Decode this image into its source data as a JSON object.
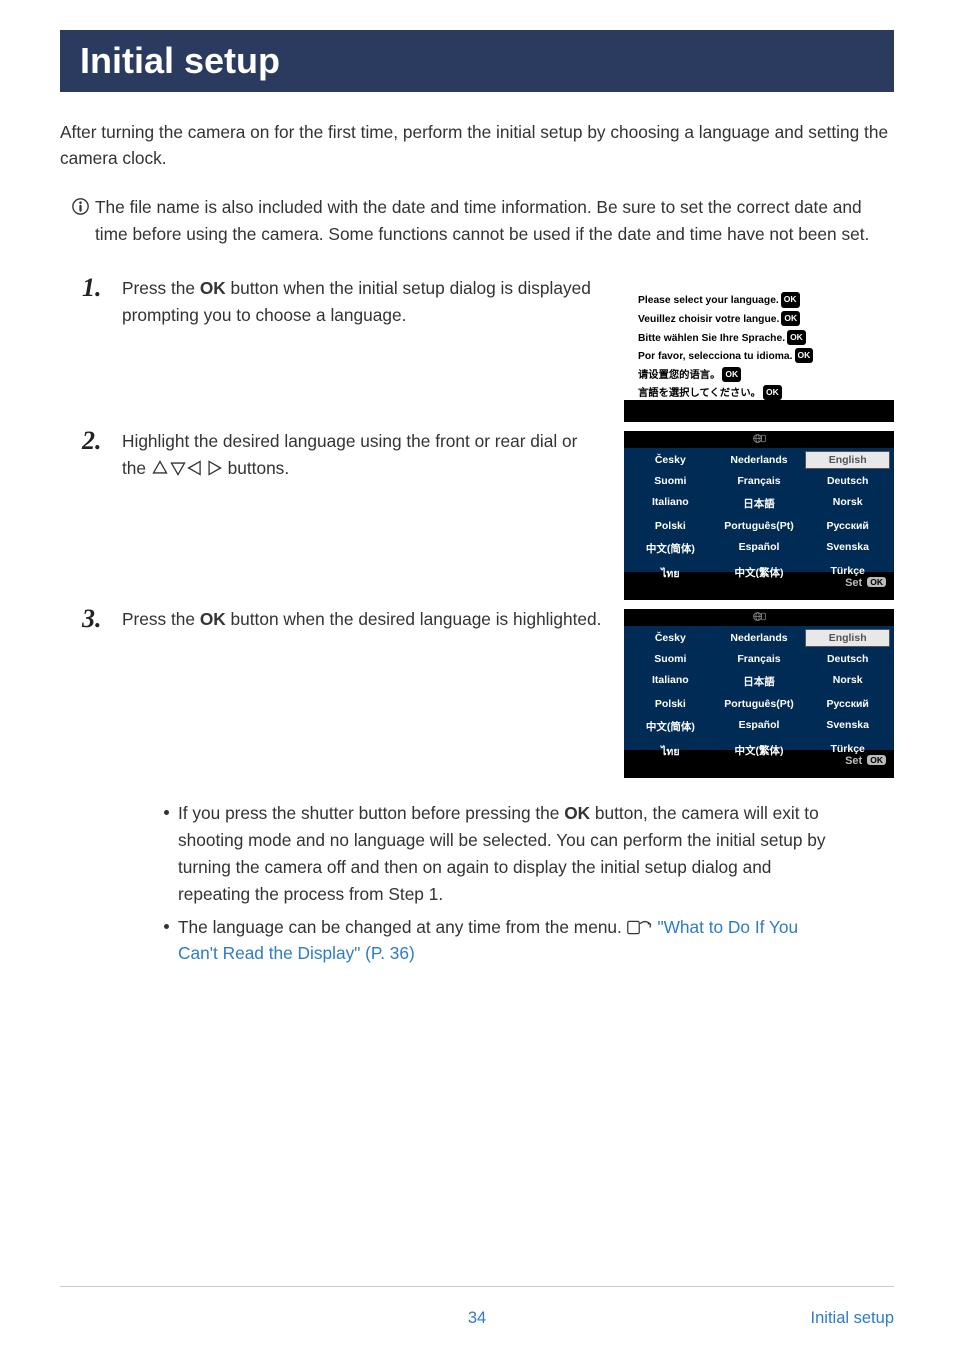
{
  "title": "Initial setup",
  "intro": "After turning the camera on for the first time, perform the initial setup by choosing a language and setting the camera clock.",
  "caution": "The file name is also included with the date and time information. Be sure to set the correct date and time before using the camera. Some functions cannot be used if the date and time have not been set.",
  "steps": {
    "s1": {
      "num": "1.",
      "text_a": "Press the ",
      "ok": "OK",
      "text_b": " button when the initial setup dialog is displayed prompting you to choose a language."
    },
    "s2": {
      "num": "2.",
      "text_a": "Highlight the desired language using the front or rear dial or the ",
      "text_b": " buttons."
    },
    "s3": {
      "num": "3.",
      "text_a": "Press the ",
      "ok": "OK",
      "text_b": " button when the desired language is highlighted."
    }
  },
  "screen1": {
    "l1": "Please select your language.",
    "l2": "Veuillez choisir votre langue.",
    "l3": "Bitte wählen Sie Ihre Sprache.",
    "l4": "Por favor, selecciona tu idioma.",
    "l5": "请设置您的语言。",
    "l6": "言語を選択してください。",
    "ok": "OK"
  },
  "lang_grid": {
    "cells": [
      "Česky",
      "Nederlands",
      "English",
      "Suomi",
      "Français",
      "Deutsch",
      "Italiano",
      "日本語",
      "Norsk",
      "Polski",
      "Português(Pt)",
      "Русский",
      "中文(简体)",
      "Español",
      "Svenska",
      "ไทย",
      "中文(繁体)",
      "Türkçe"
    ],
    "footer": "Set",
    "footer_ok": "OK"
  },
  "bullets": {
    "b1_a": "If you press the shutter button before pressing the ",
    "b1_ok": "OK",
    "b1_b": " button, the camera will exit to shooting mode and no language will be selected. You can perform the initial setup by turning the camera off and then on again to display the initial setup dialog and repeating the process from Step 1.",
    "b2_a": "The language can be changed at any time from the menu. ",
    "b2_link": "\"What to Do If You Can't Read the Display\" (P. 36)"
  },
  "footer": {
    "page": "34",
    "section": "Initial setup"
  }
}
